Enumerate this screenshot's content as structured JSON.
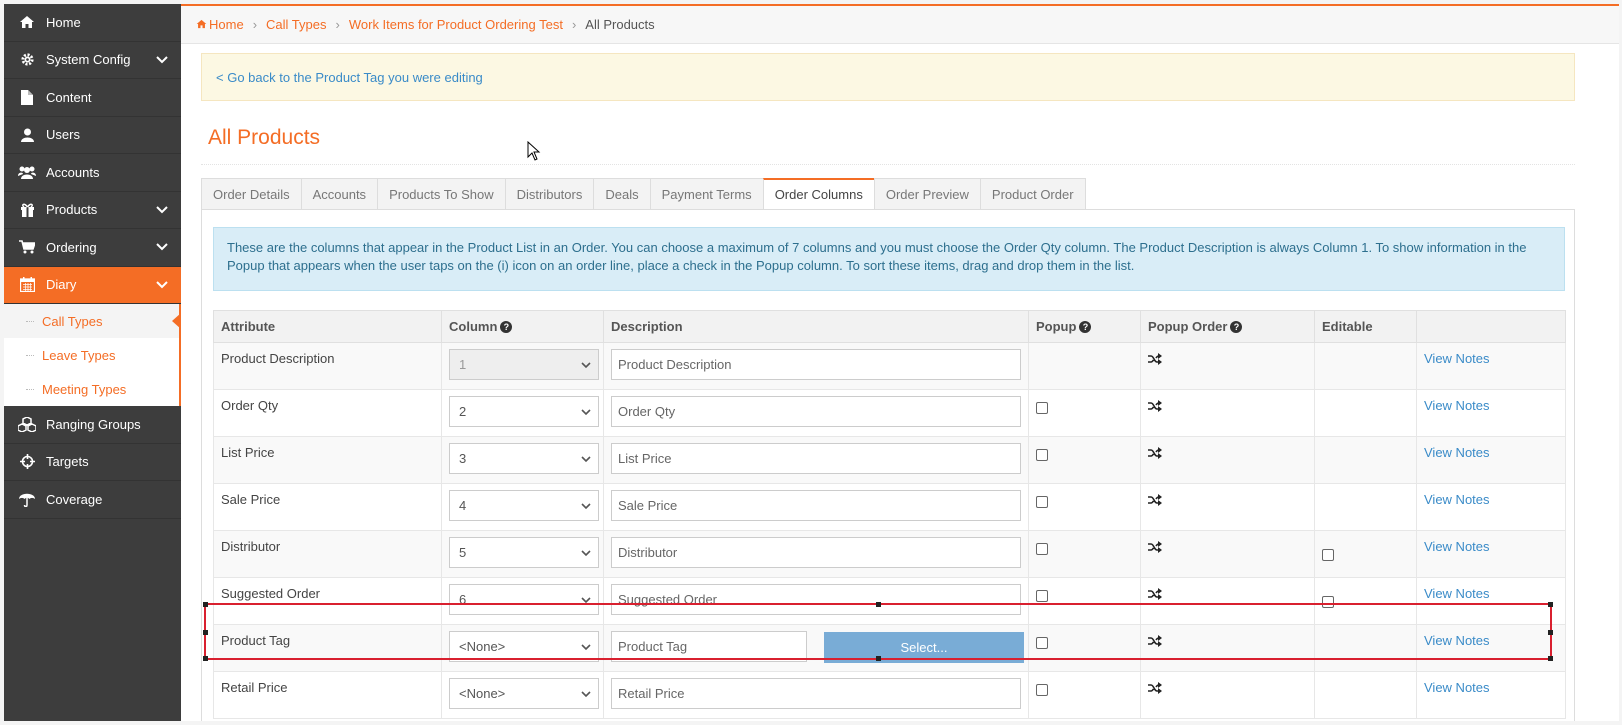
{
  "sidebar": {
    "items": [
      {
        "label": "Home",
        "icon": "home-icon"
      },
      {
        "label": "System Config",
        "icon": "gear-icon",
        "chevron": true
      },
      {
        "label": "Content",
        "icon": "file-icon"
      },
      {
        "label": "Users",
        "icon": "user-icon"
      },
      {
        "label": "Accounts",
        "icon": "users-group-icon"
      },
      {
        "label": "Products",
        "icon": "gift-icon",
        "chevron": true
      },
      {
        "label": "Ordering",
        "icon": "cart-icon",
        "chevron": true
      },
      {
        "label": "Diary",
        "icon": "calendar-icon",
        "chevron": true,
        "active": true
      }
    ],
    "diary_sub": [
      "Call Types",
      "Leave Types",
      "Meeting Types"
    ],
    "items_after": [
      {
        "label": "Ranging Groups",
        "icon": "cubes-icon"
      },
      {
        "label": "Targets",
        "icon": "crosshairs-icon"
      },
      {
        "label": "Coverage",
        "icon": "umbrella-icon"
      }
    ]
  },
  "breadcrumb": {
    "home": "Home",
    "call_types": "Call Types",
    "work_items": "Work Items for Product Ordering Test",
    "current": "All Products"
  },
  "alert": {
    "link": "< Go back to the Product Tag you were editing"
  },
  "page_title": "All Products",
  "tabs": [
    "Order Details",
    "Accounts",
    "Products To Show",
    "Distributors",
    "Deals",
    "Payment Terms",
    "Order Columns",
    "Order Preview",
    "Product Order"
  ],
  "active_tab": "Order Columns",
  "info_text": "These are the columns that appear in the Product List in an Order. You can choose a maximum of 7 columns and you must choose the Order Qty column. The Product Description is always Column 1. To show information in the Popup that appears when the user taps on the (i) icon on an order line, place a check in the Popup column. To sort these items, drag and drop them in the list.",
  "table": {
    "headers": {
      "attribute": "Attribute",
      "column": "Column",
      "description": "Description",
      "popup": "Popup",
      "popup_order": "Popup Order",
      "editable": "Editable"
    },
    "rows": [
      {
        "attribute": "Product Description",
        "column": "1",
        "description": "Product Description",
        "link": "View Notes"
      },
      {
        "attribute": "Order Qty",
        "column": "2",
        "description": "Order Qty",
        "link": "View Notes"
      },
      {
        "attribute": "List Price",
        "column": "3",
        "description": "List Price",
        "link": "View Notes"
      },
      {
        "attribute": "Sale Price",
        "column": "4",
        "description": "Sale Price",
        "link": "View Notes"
      },
      {
        "attribute": "Distributor",
        "column": "5",
        "description": "Distributor",
        "link": "View Notes"
      },
      {
        "attribute": "Suggested Order",
        "column": "6",
        "description": "Suggested Order",
        "link": "View Notes"
      },
      {
        "attribute": "Product Tag",
        "column": "<None>",
        "description": "Product Tag",
        "button": "Select...",
        "link": "View Notes"
      },
      {
        "attribute": "Retail Price",
        "column": "<None>",
        "description": "Retail Price",
        "link": "View Notes"
      }
    ]
  },
  "colors": {
    "accent": "#f46d25",
    "sidebar_bg": "#3d3d3d",
    "link": "#3a8bc8",
    "highlight": "#d9202f"
  }
}
